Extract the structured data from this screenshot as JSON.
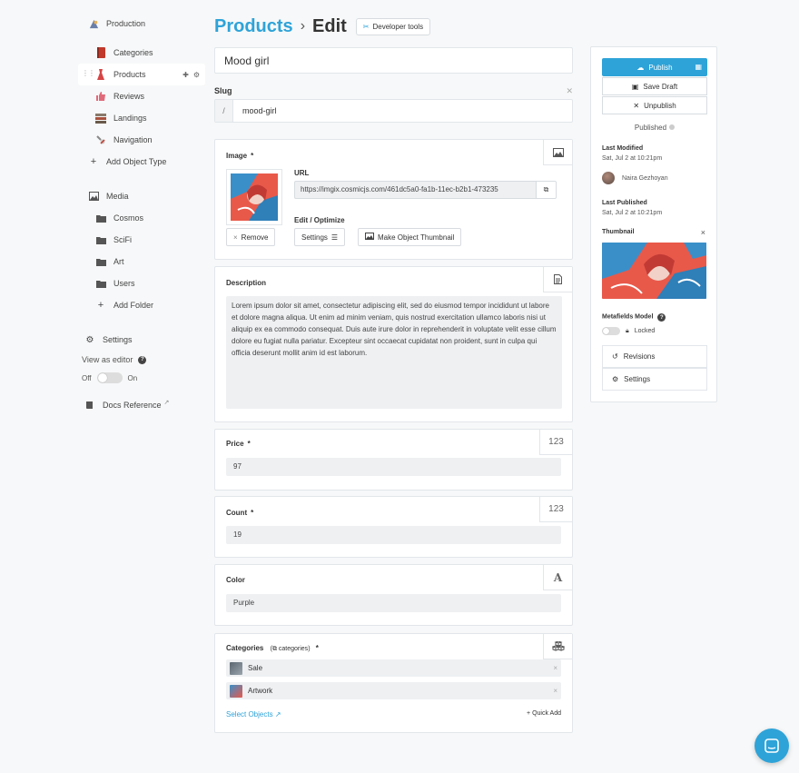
{
  "sidebar": {
    "project": "Production",
    "object_types": [
      {
        "label": "Categories"
      },
      {
        "label": "Products"
      },
      {
        "label": "Reviews"
      },
      {
        "label": "Landings"
      },
      {
        "label": "Navigation"
      }
    ],
    "add_object_type": "Add Object Type",
    "media": "Media",
    "folders": [
      {
        "label": "Cosmos"
      },
      {
        "label": "SciFi"
      },
      {
        "label": "Art"
      },
      {
        "label": "Users"
      }
    ],
    "add_folder": "Add Folder",
    "settings": "Settings",
    "view_as_editor": "View as editor",
    "toggle_off": "Off",
    "toggle_on": "On",
    "docs": "Docs Reference"
  },
  "header": {
    "breadcrumb": "Products",
    "separator": "›",
    "title": "Edit",
    "devtools": "Developer tools"
  },
  "object": {
    "title": "Mood girl",
    "slug_label": "Slug",
    "slug_prefix": "/",
    "slug": "mood-girl"
  },
  "image_field": {
    "label": "Image",
    "required": "*",
    "url_label": "URL",
    "url": "https://imgix.cosmicjs.com/461dc5a0-fa1b-11ec-b2b1-473235",
    "edit_label": "Edit / Optimize",
    "remove": "Remove",
    "settings": "Settings",
    "make_thumbnail": "Make Object Thumbnail"
  },
  "description_field": {
    "label": "Description",
    "value": "Lorem ipsum dolor sit amet, consectetur adipiscing elit, sed do eiusmod tempor incididunt ut labore et dolore magna aliqua. Ut enim ad minim veniam, quis nostrud exercitation ullamco laboris nisi ut aliquip ex ea commodo consequat. Duis aute irure dolor in reprehenderit in voluptate velit esse cillum dolore eu fugiat nulla pariatur. Excepteur sint occaecat cupidatat non proident, sunt in culpa qui officia deserunt mollit anim id est laborum."
  },
  "price_field": {
    "label": "Price",
    "required": "*",
    "type": "123",
    "value": "97"
  },
  "count_field": {
    "label": "Count",
    "required": "*",
    "type": "123",
    "value": "19"
  },
  "color_field": {
    "label": "Color",
    "type": "A",
    "value": "Purple"
  },
  "categories_field": {
    "label": "Categories",
    "ref": "categories",
    "required": "*",
    "items": [
      {
        "label": "Sale"
      },
      {
        "label": "Artwork"
      }
    ],
    "select_objects": "Select Objects",
    "quick_add": "Quick Add"
  },
  "panel": {
    "publish": "Publish",
    "save_draft": "Save Draft",
    "unpublish": "Unpublish",
    "status": "Published",
    "last_modified_label": "Last Modified",
    "last_modified": "Sat, Jul 2 at 10:21pm",
    "author": "Naira Gezhoyan",
    "last_published_label": "Last Published",
    "last_published": "Sat, Jul 2 at 10:21pm",
    "thumbnail_label": "Thumbnail",
    "metafields_label": "Metafields Model",
    "locked": "Locked",
    "revisions": "Revisions",
    "settings": "Settings"
  },
  "colors": {
    "accent": "#2ea3d8",
    "field_bg": "#eef0f2",
    "border": "#e2e6ea"
  }
}
